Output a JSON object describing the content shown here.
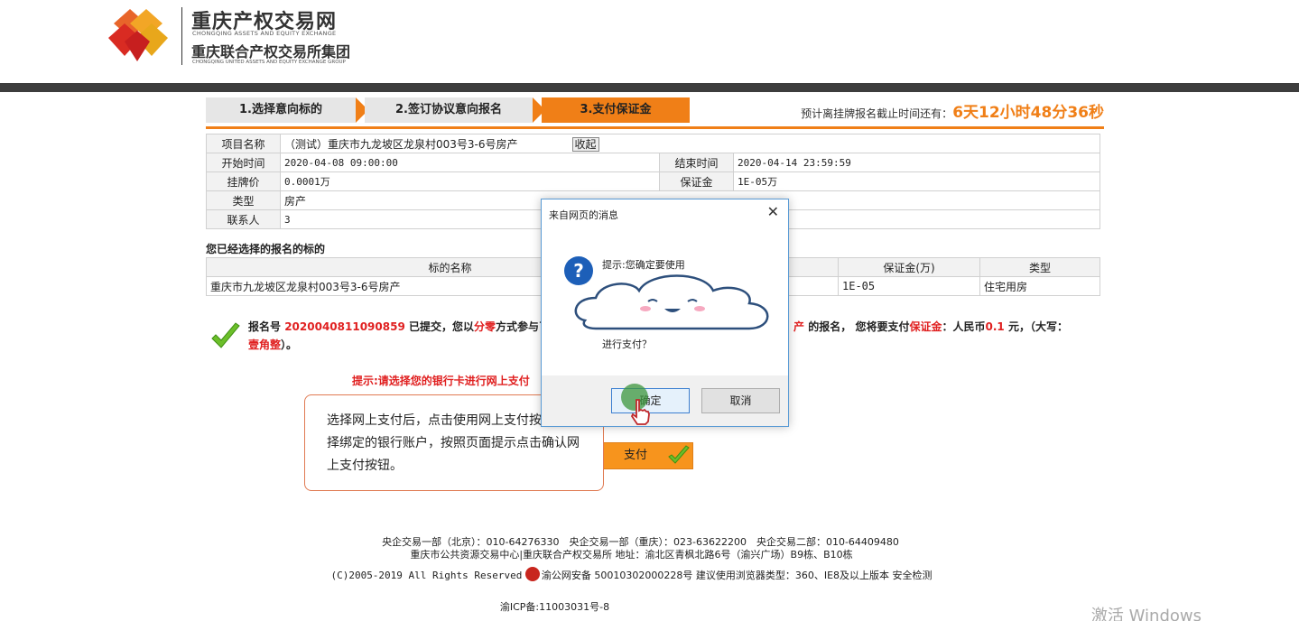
{
  "header": {
    "title": "重庆产权交易网",
    "subtitle_en": "CHONGQING ASSETS AND EQUITY EXCHANGE",
    "title2": "重庆联合产权交易所集团",
    "subtitle2_en": "CHONGQING UNITED ASSETS AND EQUITY EXCHANGE GROUP"
  },
  "steps": {
    "step1": "1.选择意向标的",
    "step2": "2.签订协议意向报名",
    "step3": "3.支付保证金",
    "countdown_label": "预计离挂牌报名截止时间还有：",
    "countdown_value": "6天12小时48分36秒"
  },
  "info": {
    "project_label": "项目名称",
    "project_value": "（测试）重庆市九龙坡区龙泉村003号3-6号房产",
    "collapse": "收起",
    "start_label": "开始时间",
    "start_value": "2020-04-08 09:00:00",
    "end_label": "结束时间",
    "end_value": "2020-04-14 23:59:59",
    "price_label": "挂牌价",
    "price_value": "0.0001万",
    "deposit_label": "保证金",
    "deposit_value": "1E-05万",
    "type_label": "类型",
    "type_value": "房产",
    "contact_label": "联系人",
    "contact_value": "3"
  },
  "chosen": {
    "title": "您已经选择的报名的标的",
    "headers": [
      "标的名称",
      "",
      "保证金(万)",
      "类型"
    ],
    "row": [
      "重庆市九龙坡区龙泉村003号3-6号房产",
      "",
      "1E-05",
      "住宅用房"
    ]
  },
  "notice": {
    "prefix": "报名号",
    "reg_no": "2020040811090859",
    "part1": "已提交，您以",
    "mode": "分零",
    "part2": "方式参与了项",
    "asset": "产",
    "part3": "的报名，",
    "part4": "您将要支付",
    "deposit_word": "保证金",
    "part5": "：人民币",
    "amount": "0.1",
    "part6": "元，（大写：",
    "amount_cn": "壹角整",
    "part7": "）。"
  },
  "hint": "提示:请选择您的银行卡进行网上支付",
  "pay_button": "支付",
  "callout": "选择网上支付后，点击使用网上支付按钮，选择绑定的银行账户，按照页面提示点击确认网上支付按钮。",
  "dialog": {
    "title": "来自网页的消息",
    "line1": "提示:您确定要使用",
    "line2": "进行支付？",
    "ok": "确定",
    "cancel": "取消"
  },
  "footer": {
    "line1": "央企交易一部（北京）：010-64276330　央企交易一部（重庆）：023-63622200　央企交易二部：010-64409480",
    "line2": "重庆市公共资源交易中心|重庆联合产权交易所 地址：渝北区青枫北路6号（渝兴广场）B9栋、B10栋",
    "line3_a": "(C)2005-2019  All Rights Reserved",
    "line3_b": "渝公网安备 50010302000228号",
    "line3_c": "建议使用浏览器类型：360、IE8及以上版本 安全检测",
    "line4": "渝ICP备:11003031号-8"
  },
  "watermark": "激活 Windows"
}
